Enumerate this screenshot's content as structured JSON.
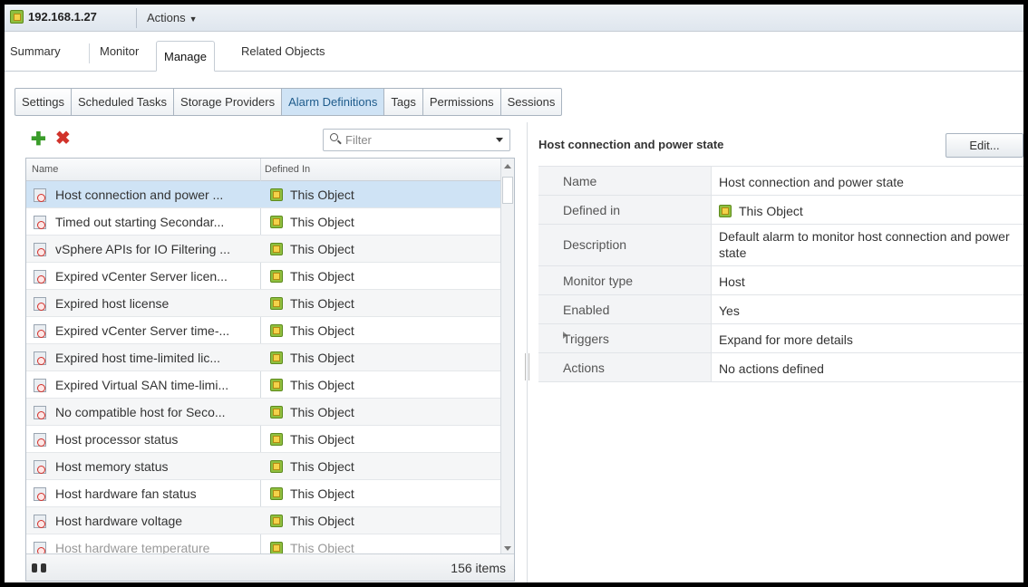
{
  "window": {
    "host": "192.168.1.27",
    "actions_label": "Actions"
  },
  "main_tabs": [
    {
      "label": "Summary"
    },
    {
      "label": "Monitor"
    },
    {
      "label": "Manage"
    },
    {
      "label": "Related Objects"
    }
  ],
  "sub_tabs": [
    {
      "label": "Settings"
    },
    {
      "label": "Scheduled Tasks"
    },
    {
      "label": "Storage Providers"
    },
    {
      "label": "Alarm Definitions"
    },
    {
      "label": "Tags"
    },
    {
      "label": "Permissions"
    },
    {
      "label": "Sessions"
    }
  ],
  "active_sub_tab": "Alarm Definitions",
  "list": {
    "filter_placeholder": "Filter",
    "columns": {
      "name": "Name",
      "defined_in": "Defined In"
    },
    "rows": [
      {
        "name": "Host connection and power ...",
        "defined_in": "This Object"
      },
      {
        "name": "Timed out starting Secondar...",
        "defined_in": "This Object"
      },
      {
        "name": "vSphere APIs for IO Filtering ...",
        "defined_in": "This Object"
      },
      {
        "name": "Expired vCenter Server licen...",
        "defined_in": "This Object"
      },
      {
        "name": "Expired host license",
        "defined_in": "This Object"
      },
      {
        "name": "Expired vCenter Server time-...",
        "defined_in": "This Object"
      },
      {
        "name": "Expired host time-limited lic...",
        "defined_in": "This Object"
      },
      {
        "name": "Expired Virtual SAN time-limi...",
        "defined_in": "This Object"
      },
      {
        "name": "No compatible host for Seco...",
        "defined_in": "This Object"
      },
      {
        "name": "Host processor status",
        "defined_in": "This Object"
      },
      {
        "name": "Host memory status",
        "defined_in": "This Object"
      },
      {
        "name": "Host hardware fan status",
        "defined_in": "This Object"
      },
      {
        "name": "Host hardware voltage",
        "defined_in": "This Object"
      },
      {
        "name": "Host hardware temperature",
        "defined_in": "This Object"
      }
    ],
    "item_count": "156 items"
  },
  "detail": {
    "title": "Host connection and power state",
    "edit_label": "Edit...",
    "properties": [
      {
        "label": "Name",
        "value": "Host connection and power state"
      },
      {
        "label": "Defined in",
        "value": "This Object"
      },
      {
        "label": "Description",
        "value": "Default alarm to monitor host connection and power state"
      },
      {
        "label": "Monitor type",
        "value": "Host"
      },
      {
        "label": "Enabled",
        "value": "Yes"
      },
      {
        "label": "Triggers",
        "value": "Expand for more details"
      },
      {
        "label": "Actions",
        "value": "No actions defined"
      }
    ]
  },
  "colors": {
    "selection": "#cfe3f5",
    "add_icon": "#3a9c2a",
    "delete_icon": "#d1332b",
    "host_icon": "#8fbf3f"
  }
}
